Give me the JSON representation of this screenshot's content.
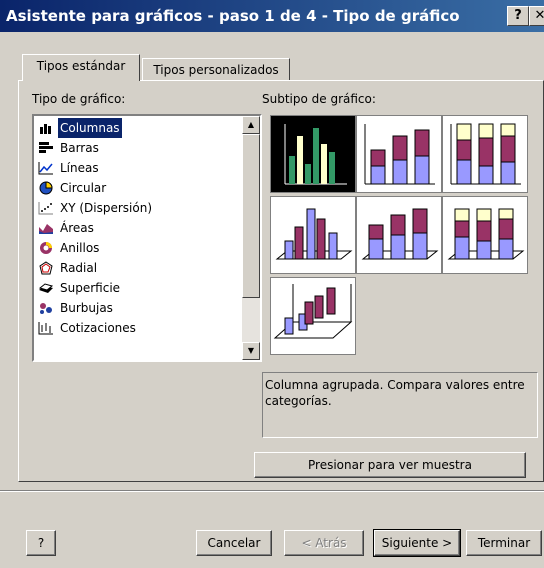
{
  "window": {
    "title": "Asistente para gráficos - paso 1 de 4 - Tipo de gráfico",
    "help_glyph": "?",
    "close_glyph": "✕"
  },
  "tabs": [
    {
      "label": "Tipos estándar",
      "active": true
    },
    {
      "label": "Tipos personalizados",
      "active": false
    }
  ],
  "chart_type": {
    "label": "Tipo de gráfico:",
    "items": [
      {
        "label": "Columnas",
        "icon": "column-chart-icon",
        "selected": true
      },
      {
        "label": "Barras",
        "icon": "bar-chart-icon"
      },
      {
        "label": "Líneas",
        "icon": "line-chart-icon"
      },
      {
        "label": "Circular",
        "icon": "pie-chart-icon"
      },
      {
        "label": "XY (Dispersión)",
        "icon": "scatter-chart-icon"
      },
      {
        "label": "Áreas",
        "icon": "area-chart-icon"
      },
      {
        "label": "Anillos",
        "icon": "doughnut-chart-icon"
      },
      {
        "label": "Radial",
        "icon": "radar-chart-icon"
      },
      {
        "label": "Superficie",
        "icon": "surface-chart-icon"
      },
      {
        "label": "Burbujas",
        "icon": "bubble-chart-icon"
      },
      {
        "label": "Cotizaciones",
        "icon": "stock-chart-icon"
      }
    ]
  },
  "subtype": {
    "label": "Subtipo de gráfico:",
    "description": "Columna agrupada. Compara valores entre categorías."
  },
  "buttons": {
    "preview": "Presionar para ver muestra",
    "help": "?",
    "cancel": "Cancelar",
    "back": "< Atrás",
    "next": "Siguiente >",
    "finish": "Terminar"
  },
  "colors": {
    "titlebar": "#0a246a",
    "selection": "#0a246a",
    "series_blue": "#9999ff",
    "series_red": "#993366",
    "series_yellow": "#ffffcc",
    "selected_green": "#339966"
  }
}
